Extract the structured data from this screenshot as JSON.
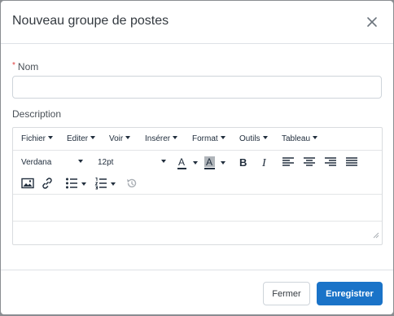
{
  "modal": {
    "title": "Nouveau groupe de postes"
  },
  "form": {
    "required_mark": "*",
    "name_label": "Nom",
    "name_value": "",
    "description_label": "Description"
  },
  "editor": {
    "menus": [
      "Fichier",
      "Editer",
      "Voir",
      "Insérer",
      "Format",
      "Outils",
      "Tableau"
    ],
    "font_family": "Verdana",
    "font_size": "12pt",
    "text_color_glyph": "A",
    "highlight_glyph": "A",
    "bold_glyph": "B",
    "italic_glyph": "I",
    "text_color": "#e03e3e",
    "highlight_color": "#b0b5ba"
  },
  "footer": {
    "close_label": "Fermer",
    "save_label": "Enregistrer"
  },
  "colors": {
    "primary": "#1a73c8",
    "overlay": "#8a8d91"
  }
}
